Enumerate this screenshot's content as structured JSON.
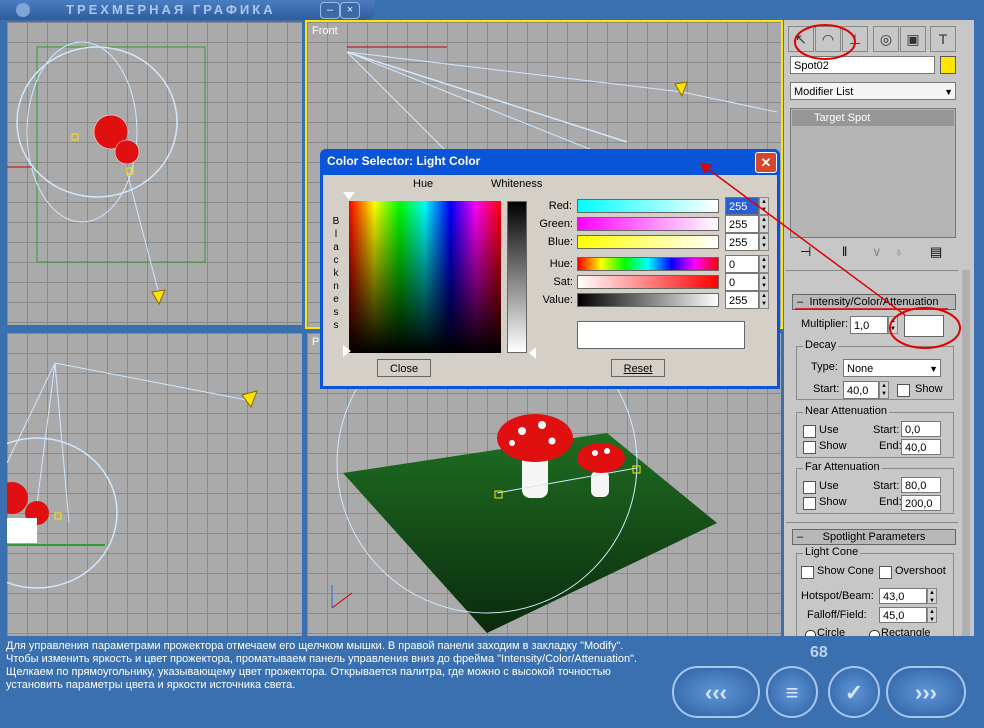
{
  "window": {
    "title": "ТРЕХМЕРНАЯ ГРАФИКА",
    "minimize": "–",
    "close": "×"
  },
  "viewports": {
    "front_label": "Front",
    "perspective_label": "P"
  },
  "command_panel": {
    "object_name": "Spot02",
    "object_color": "#ffe600",
    "modifier_list": "Modifier List",
    "stack_item": "Target Spot",
    "rollout_intensity": "Intensity/Color/Attenuation",
    "multiplier_label": "Multiplier:",
    "multiplier_value": "1,0",
    "decay": {
      "title": "Decay",
      "type_label": "Type:",
      "type_value": "None",
      "start_label": "Start:",
      "start_value": "40,0",
      "show_label": "Show"
    },
    "near_attenuation": {
      "title": "Near Attenuation",
      "use_label": "Use",
      "show_label": "Show",
      "start_label": "Start:",
      "start_value": "0,0",
      "end_label": "End:",
      "end_value": "40,0"
    },
    "far_attenuation": {
      "title": "Far Attenuation",
      "use_label": "Use",
      "show_label": "Show",
      "start_label": "Start:",
      "start_value": "80,0",
      "end_label": "End:",
      "end_value": "200,0"
    },
    "rollout_spotlight": "Spotlight Parameters",
    "light_cone": {
      "title": "Light Cone",
      "show_cone": "Show Cone",
      "overshoot": "Overshoot",
      "hotspot_label": "Hotspot/Beam:",
      "hotspot_value": "43,0",
      "falloff_label": "Falloff/Field:",
      "falloff_value": "45,0",
      "circle": "Circle",
      "rectangle": "Rectangle"
    }
  },
  "color_selector": {
    "title": "Color Selector: Light Color",
    "hue_header": "Hue",
    "whiteness_header": "Whiteness",
    "blackness_letters": [
      "B",
      "l",
      "a",
      "c",
      "k",
      "n",
      "e",
      "s",
      "s"
    ],
    "red_label": "Red:",
    "red_value": "255",
    "green_label": "Green:",
    "green_value": "255",
    "blue_label": "Blue:",
    "blue_value": "255",
    "hue_label": "Hue:",
    "hue_value": "0",
    "sat_label": "Sat:",
    "sat_value": "0",
    "value_label": "Value:",
    "value_value": "255",
    "close_button": "Close",
    "reset_button": "Reset"
  },
  "footer": {
    "description": "Для управления параметрами прожектора отмечаем его щелчком мышки. В правой панели заходим в закладку \"Modify\". Чтобы изменить яркость и цвет прожектора, проматываем панель управления вниз до фрейма \"Intensity/Color/Attenuation\". Щелкаем по прямоугольнику, указывающему цвет прожектора. Открывается палитра, где можно с высокой точностью установить параметры цвета и яркости источника света.",
    "page_number": "68",
    "nav_first": "‹‹‹",
    "nav_menu": "≡",
    "nav_check": "✓",
    "nav_next": "›››"
  },
  "colors": {
    "annotation": "#e00000",
    "frame_blue": "#3a6fb0",
    "dialog_blue": "#0a54d8"
  }
}
